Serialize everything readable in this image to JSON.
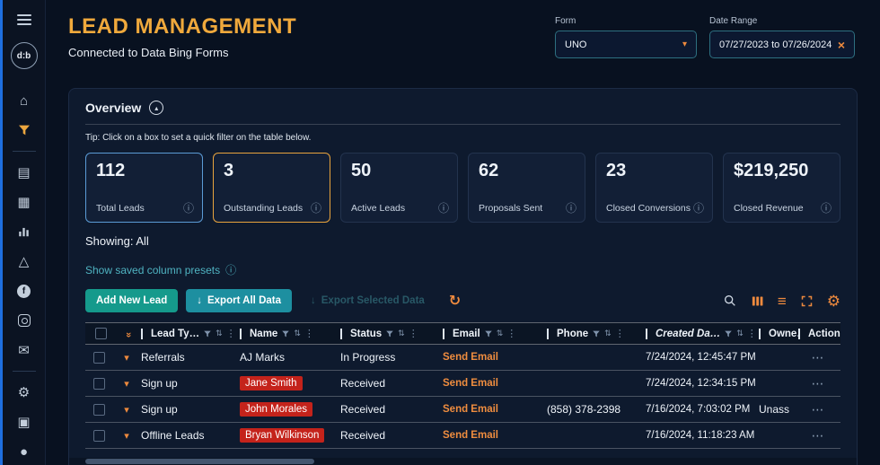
{
  "glyphs": {
    "home": "⌂",
    "documents": "▤",
    "forms": "▦",
    "alerts": "△",
    "facebook": "f",
    "mail": "✉",
    "settings": "⚙",
    "cards": "▣",
    "github": "●",
    "caret": "▾",
    "close": "×",
    "info": "ⓘ",
    "collapse": "▴",
    "refresh": "↻",
    "download": "↓",
    "list": "≡",
    "gear": "⚙",
    "sort": "⇅",
    "menu": "⋮",
    "expand": "▾",
    "dbl_expand": "»",
    "overflow": "⋯"
  },
  "sidebar": {
    "logo": "d:b"
  },
  "header": {
    "title": "LEAD MANAGEMENT",
    "subtitle": "Connected to Data Bing Forms"
  },
  "filters": {
    "form_label": "Form",
    "form_value": "UNO",
    "date_label": "Date Range",
    "date_value": "07/27/2023 to 07/26/2024"
  },
  "overview": {
    "title": "Overview",
    "tip": "Tip: Click on a box to set a quick filter on the table below.",
    "cards": [
      {
        "value": "112",
        "label": "Total Leads"
      },
      {
        "value": "3",
        "label": "Outstanding Leads"
      },
      {
        "value": "50",
        "label": "Active Leads"
      },
      {
        "value": "62",
        "label": "Proposals Sent"
      },
      {
        "value": "23",
        "label": "Closed Conversions"
      },
      {
        "value": "$219,250",
        "label": "Closed Revenue"
      }
    ],
    "showing": "Showing: All",
    "presets": "Show saved column presets"
  },
  "toolbar": {
    "add": "Add New Lead",
    "export_all": "Export All Data",
    "export_selected": "Export Selected Data"
  },
  "table": {
    "headers": [
      "Lead Ty…",
      "Name",
      "Status",
      "Email",
      "Phone",
      "Created Da…",
      "Owne…",
      "Actions"
    ],
    "rows": [
      {
        "lead_type": "Referrals",
        "name": "AJ Marks",
        "status": "In Progress",
        "email": "Send Email",
        "phone": "",
        "created": "7/24/2024, 12:45:47 PM",
        "owner": ""
      },
      {
        "lead_type": "Sign up",
        "name": "Jane Smith",
        "status": "Received",
        "email": "Send Email",
        "phone": "",
        "created": "7/24/2024, 12:34:15 PM",
        "owner": ""
      },
      {
        "lead_type": "Sign up",
        "name": "John Morales",
        "status": "Received",
        "email": "Send Email",
        "phone": "(858) 378-2398",
        "created": "7/16/2024, 7:03:02 PM",
        "owner": "Unass"
      },
      {
        "lead_type": "Offline Leads",
        "name": "Bryan Wilkinson",
        "status": "Received",
        "email": "Send Email",
        "phone": "",
        "created": "7/16/2024, 11:18:23 AM",
        "owner": ""
      }
    ]
  }
}
